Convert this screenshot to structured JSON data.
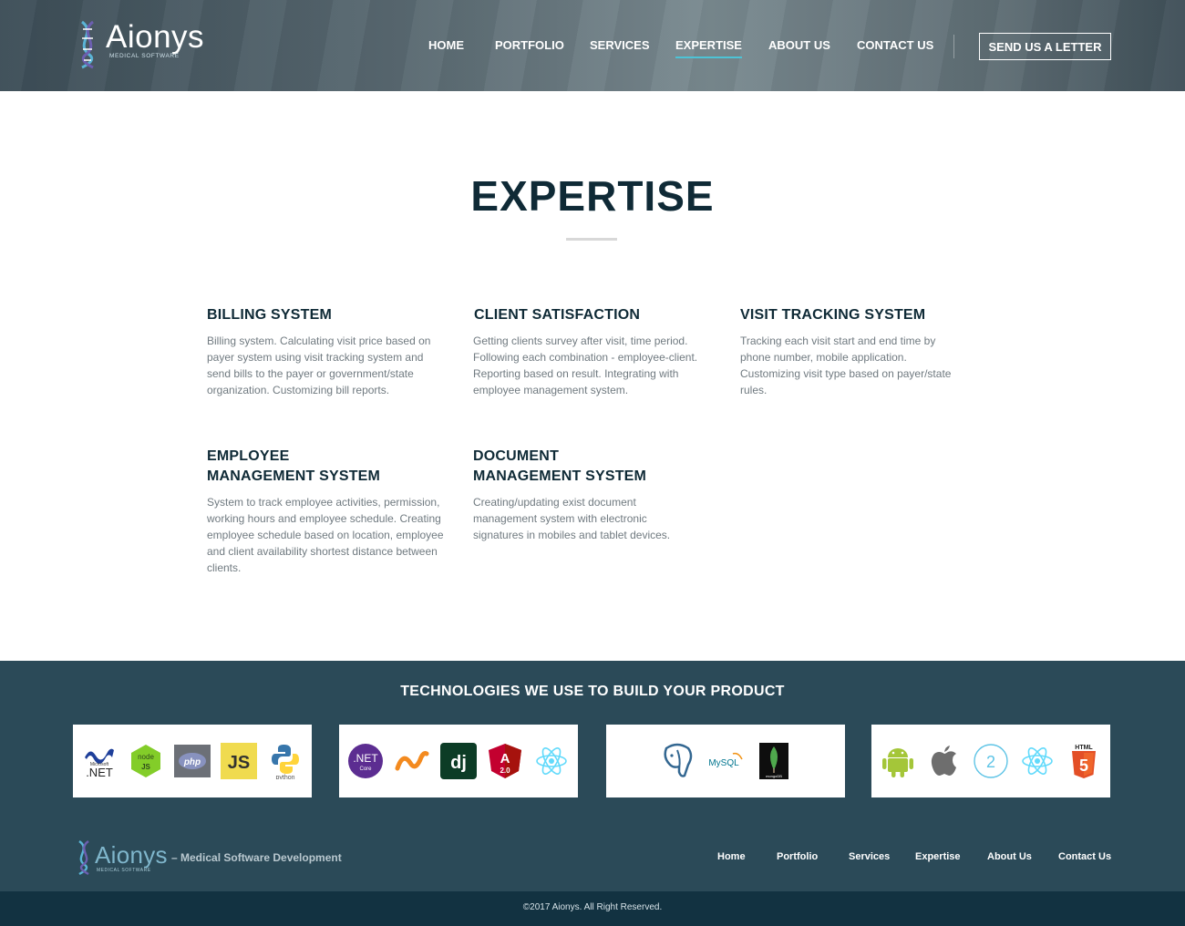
{
  "brand": {
    "name": "Aionys",
    "subtitle": "MEDICAL SOFTWARE"
  },
  "nav": {
    "items": [
      {
        "label": "HOME"
      },
      {
        "label": "PORTFOLIO"
      },
      {
        "label": "SERVICES"
      },
      {
        "label": "EXPERTISE",
        "active": true
      },
      {
        "label": "ABOUT US"
      },
      {
        "label": "CONTACT US"
      }
    ],
    "cta": "SEND US A LETTER"
  },
  "page": {
    "title": "EXPERTISE"
  },
  "expertise": [
    {
      "title": "BILLING SYSTEM",
      "text": "Billing system. Calculating visit price based on payer system using visit tracking system and send bills to the payer or government/state organization. Customizing bill reports."
    },
    {
      "title": "CLIENT SATISFACTION",
      "text": "Getting clients survey after visit, time period. Following each combination - employee-client. Reporting based on result. Integrating with employee management system."
    },
    {
      "title": "VISIT TRACKING SYSTEM",
      "text": "Tracking each visit start and end time by phone number, mobile application. Customizing visit type based on payer/state rules."
    },
    {
      "title_line1": "EMPLOYEE",
      "title_line2": "MANAGEMENT SYSTEM",
      "text": "System to track employee activities, permission, working hours and employee schedule. Creating employee schedule based on location, employee and client availability shortest distance between clients."
    },
    {
      "title_line1": "DOCUMENT",
      "title_line2": "MANAGEMENT SYSTEM",
      "text": "Creating/updating exist document management system with electronic signatures in mobiles and tablet devices."
    }
  ],
  "technologies": {
    "title": "TECHNOLOGIES WE USE TO BUILD YOUR PRODUCT",
    "groups": [
      {
        "icons": [
          "dotnet-icon",
          "nodejs-icon",
          "php-icon",
          "javascript-icon",
          "python-icon"
        ]
      },
      {
        "icons": [
          "dotnet-core-icon",
          "nativescript-icon",
          "django-icon",
          "angular-icon",
          "react-icon"
        ]
      },
      {
        "icons": [
          "postgresql-icon",
          "mysql-icon",
          "mongodb-icon"
        ]
      },
      {
        "icons": [
          "android-icon",
          "apple-icon",
          "swift2-icon",
          "react-native-icon",
          "html5-icon"
        ]
      }
    ],
    "logo_text": {
      "microsoft": "Microsoft",
      "dotnet": ".NET",
      "node": "node",
      "node_js": "JS",
      "php": "php",
      "js": "JS",
      "python": "python",
      "dotnet_core": ".NET",
      "core": "Core",
      "django": "dj",
      "angular": "A",
      "angular_version": "2.0",
      "mysql": "MySQL",
      "mongodb": "mongoDB",
      "swift": "2",
      "html5_label": "HTML",
      "html5_num": "5"
    }
  },
  "footer": {
    "tagline": "– Medical Software Development",
    "nav": [
      "Home",
      "Portfolio",
      "Services",
      "Expertise",
      "About Us",
      "Contact Us"
    ],
    "copyright": "©2017 Aionys. All Right Reserved."
  },
  "colors": {
    "header_bg": "#4e5e67",
    "accent": "#4dc3d6",
    "heading": "#0f2a36",
    "band_bg": "#2b4a58",
    "copyright_bg": "#123241"
  }
}
